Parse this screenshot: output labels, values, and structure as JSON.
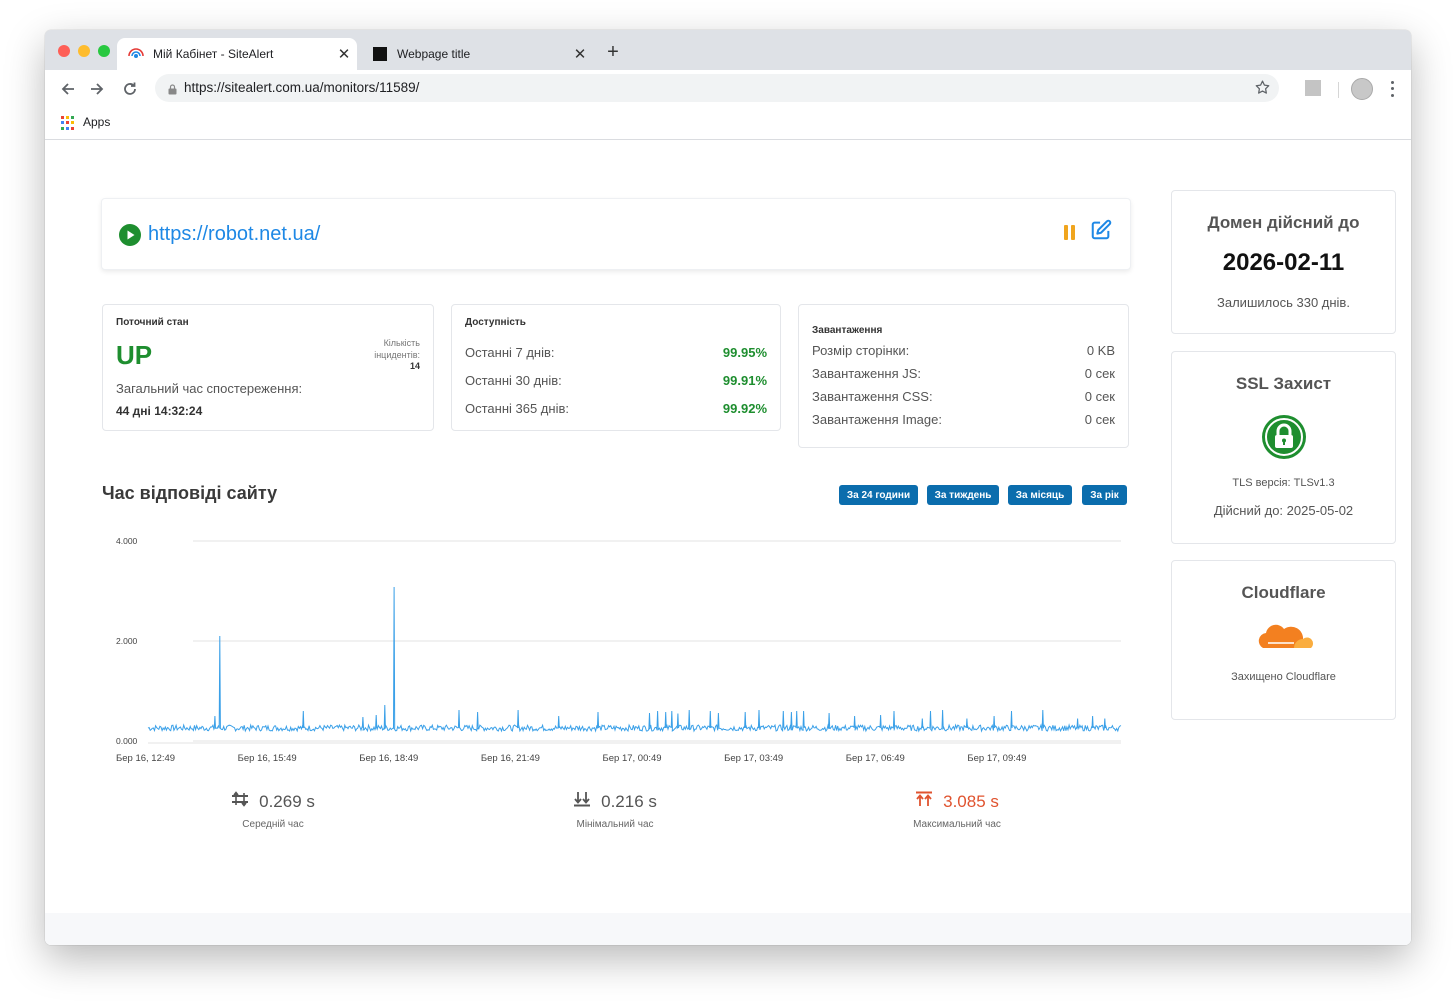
{
  "browser": {
    "tabs": [
      {
        "title": "Мій Кабінет - SiteAlert",
        "active": true
      },
      {
        "title": "Webpage title",
        "active": false
      }
    ],
    "url": "https://sitealert.com.ua/monitors/11589/",
    "bookmarks_label": "Apps"
  },
  "monitor": {
    "site_url": "https://robot.net.ua/",
    "colors": {
      "accent": "#1e88e5",
      "up": "#1e8e2f",
      "button": "#0b6dad",
      "max": "#e0532f",
      "pause": "#f0a51e"
    }
  },
  "current_state": {
    "title": "Поточний стан",
    "state": "UP",
    "incidents_label": "Кількість інцидентів:",
    "incidents_value": "14",
    "total_label": "Загальний час спостереження:",
    "total_value": "44 дні 14:32:24"
  },
  "availability": {
    "title": "Доступність",
    "rows": [
      {
        "label": "Останні 7 днів:",
        "value": "99.95%"
      },
      {
        "label": "Останні 30 днів:",
        "value": "99.91%"
      },
      {
        "label": "Останні 365 днів:",
        "value": "99.92%"
      }
    ]
  },
  "loading": {
    "title": "Завантаження",
    "rows": [
      {
        "label": "Розмір сторінки:",
        "value": "0 KB"
      },
      {
        "label": "Завантаження JS:",
        "value": "0 сек"
      },
      {
        "label": "Завантаження CSS:",
        "value": "0 сек"
      },
      {
        "label": "Завантаження Image:",
        "value": "0 сек"
      }
    ]
  },
  "response": {
    "title": "Час відповіді сайту",
    "ranges": [
      "За 24 години",
      "За тиждень",
      "За місяць",
      "За рік"
    ],
    "summary": [
      {
        "value": "0.269 s",
        "label": "Середній час",
        "icon": "arrows-up-down-icon"
      },
      {
        "value": "0.216 s",
        "label": "Мінімальний час",
        "icon": "arrows-down-bar-icon"
      },
      {
        "value": "3.085 s",
        "label": "Максимальний час",
        "icon": "arrows-up-bar-icon"
      }
    ]
  },
  "chart_data": {
    "type": "line",
    "title": "",
    "xlabel": "",
    "ylabel": "",
    "ylim": [
      0,
      4
    ],
    "yticks": [
      "0.000",
      "2.000",
      "4.000"
    ],
    "xticks": [
      "Бер 16, 12:49",
      "Бер 16, 15:49",
      "Бер 16, 18:49",
      "Бер 16, 21:49",
      "Бер 17, 00:49",
      "Бер 17, 03:49",
      "Бер 17, 06:49",
      "Бер 17, 09:49"
    ],
    "grid": true,
    "baseline": 0.26,
    "x_range_hours": [
      0,
      24
    ],
    "spikes": [
      {
        "t": 1.65,
        "v": 0.5
      },
      {
        "t": 1.77,
        "v": 2.1
      },
      {
        "t": 3.83,
        "v": 0.6
      },
      {
        "t": 5.3,
        "v": 0.48
      },
      {
        "t": 5.63,
        "v": 0.52
      },
      {
        "t": 5.84,
        "v": 0.72
      },
      {
        "t": 6.07,
        "v": 3.08
      },
      {
        "t": 7.67,
        "v": 0.62
      },
      {
        "t": 8.13,
        "v": 0.58
      },
      {
        "t": 9.13,
        "v": 0.62
      },
      {
        "t": 10.13,
        "v": 0.5
      },
      {
        "t": 11.1,
        "v": 0.58
      },
      {
        "t": 12.37,
        "v": 0.56
      },
      {
        "t": 12.57,
        "v": 0.6
      },
      {
        "t": 12.77,
        "v": 0.58
      },
      {
        "t": 12.92,
        "v": 0.6
      },
      {
        "t": 13.07,
        "v": 0.55
      },
      {
        "t": 13.35,
        "v": 0.62
      },
      {
        "t": 13.87,
        "v": 0.6
      },
      {
        "t": 14.07,
        "v": 0.56
      },
      {
        "t": 14.73,
        "v": 0.58
      },
      {
        "t": 15.07,
        "v": 0.62
      },
      {
        "t": 15.67,
        "v": 0.6
      },
      {
        "t": 15.87,
        "v": 0.58
      },
      {
        "t": 16.0,
        "v": 0.6
      },
      {
        "t": 16.17,
        "v": 0.6
      },
      {
        "t": 16.8,
        "v": 0.56
      },
      {
        "t": 17.43,
        "v": 0.5
      },
      {
        "t": 18.07,
        "v": 0.52
      },
      {
        "t": 18.4,
        "v": 0.6
      },
      {
        "t": 19.1,
        "v": 0.45
      },
      {
        "t": 19.3,
        "v": 0.6
      },
      {
        "t": 19.6,
        "v": 0.62
      },
      {
        "t": 20.2,
        "v": 0.45
      },
      {
        "t": 20.87,
        "v": 0.5
      },
      {
        "t": 21.3,
        "v": 0.6
      },
      {
        "t": 22.07,
        "v": 0.62
      },
      {
        "t": 22.93,
        "v": 0.45
      },
      {
        "t": 23.3,
        "v": 0.5
      },
      {
        "t": 23.6,
        "v": 0.45
      }
    ]
  },
  "domain": {
    "title": "Домен дійсний до",
    "date": "2026-02-11",
    "remaining": "Залишилось 330 днів."
  },
  "ssl": {
    "title": "SSL Захист",
    "tls": "TLS версія: TLSv1.3",
    "valid": "Дійсний до: 2025-05-02"
  },
  "cloudflare": {
    "title": "Cloudflare",
    "note": "Захищено Cloudflare"
  }
}
